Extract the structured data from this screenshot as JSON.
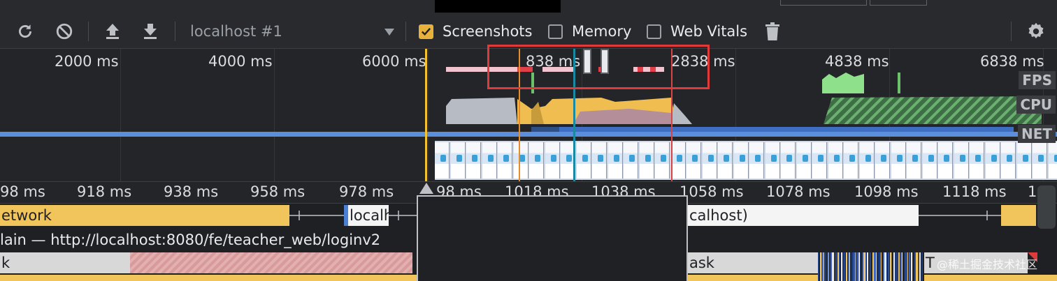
{
  "toolbar": {
    "target": "localhost #1",
    "checkboxes": [
      {
        "label": "Screenshots",
        "checked": true
      },
      {
        "label": "Memory",
        "checked": false
      },
      {
        "label": "Web Vitals",
        "checked": false
      }
    ],
    "icons": [
      "reload-icon",
      "clear-icon",
      "upload-icon",
      "download-icon",
      "trash-icon",
      "gear-icon"
    ]
  },
  "overview": {
    "time_labels": [
      "2000 ms",
      "4000 ms",
      "6000 ms",
      "838 ms",
      "2838 ms",
      "4838 ms",
      "6838 ms"
    ],
    "lanes": [
      "FPS",
      "CPU",
      "NET"
    ]
  },
  "ruler": {
    "ticks": [
      "98 ms",
      "918 ms",
      "938 ms",
      "958 ms",
      "978 ms",
      "98 ms",
      "1018 ms",
      "1038 ms",
      "1058 ms",
      "1078 ms",
      "1098 ms",
      "1118 ms",
      "1"
    ]
  },
  "flame": {
    "network_label": "etwork",
    "localhost_label": "localh",
    "localhost_right": "calhost)",
    "main_label": "lain — http://localhost:8080/fe/teacher_web/loginv2",
    "task_left": "k",
    "task_right": "ask",
    "task_far": "T"
  },
  "watermark": "@稀土掘金技术社区",
  "colors": {
    "accent": "#e8b23a",
    "highlight_box": "#e03b3b",
    "network_bar": "#f2c55c"
  }
}
